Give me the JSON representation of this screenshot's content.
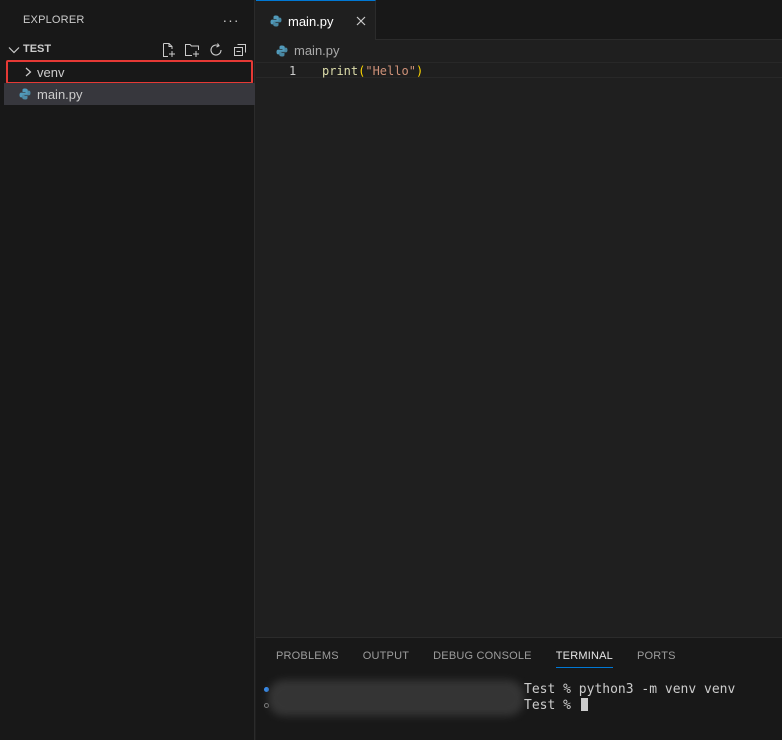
{
  "sidebar": {
    "title": "EXPLORER",
    "more_label": "···",
    "section_title": "TEST",
    "actions": [
      "new-file-icon",
      "new-folder-icon",
      "refresh-icon",
      "collapse-all-icon"
    ],
    "items": [
      {
        "label": "venv",
        "kind": "folder",
        "expanded": false,
        "highlighted": true
      },
      {
        "label": "main.py",
        "kind": "file",
        "selected": true
      }
    ]
  },
  "editor": {
    "tab_label": "main.py",
    "breadcrumb": "main.py",
    "line_number": "1",
    "code": {
      "fn": "print",
      "open": "(",
      "str": "\"Hello\"",
      "close": ")"
    }
  },
  "panel": {
    "tabs": [
      "PROBLEMS",
      "OUTPUT",
      "DEBUG CONSOLE",
      "TERMINAL",
      "PORTS"
    ],
    "active_tab": "TERMINAL",
    "terminal_lines": [
      "Test % python3 -m venv venv",
      "Test % "
    ]
  },
  "colors": {
    "accent": "#0078d4",
    "highlight_border": "#e53935",
    "python_icon": "#519aba"
  }
}
